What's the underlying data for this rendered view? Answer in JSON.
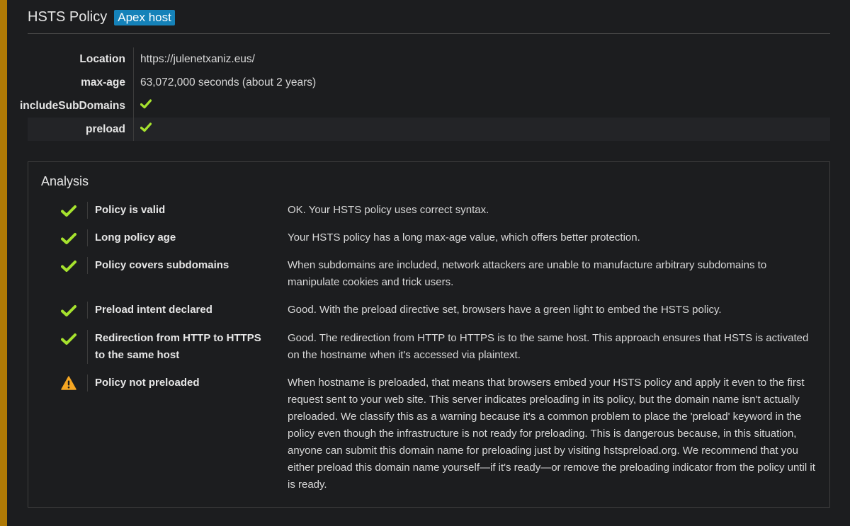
{
  "header": {
    "title": "HSTS Policy",
    "badge": "Apex host"
  },
  "policy": [
    {
      "key": "Location",
      "value": "https://julenetxaniz.eus/",
      "check": false
    },
    {
      "key": "max-age",
      "value": "63,072,000 seconds (about 2 years)",
      "check": false
    },
    {
      "key": "includeSubDomains",
      "value": "",
      "check": true
    },
    {
      "key": "preload",
      "value": "",
      "check": true
    }
  ],
  "analysis": {
    "title": "Analysis",
    "items": [
      {
        "status": "check-icon",
        "name": "Policy is valid",
        "desc": "OK. Your HSTS policy uses correct syntax."
      },
      {
        "status": "check-icon",
        "name": "Long policy age",
        "desc": "Your HSTS policy has a long max-age value, which offers better protection."
      },
      {
        "status": "check-icon",
        "name": "Policy covers subdomains",
        "desc": "When subdomains are included, network attackers are unable to manufacture arbitrary subdomains to manipulate cookies and trick users."
      },
      {
        "status": "check-icon",
        "name": "Preload intent declared",
        "desc": "Good. With the preload directive set, browsers have a green light to embed the HSTS policy."
      },
      {
        "status": "check-icon",
        "name": "Redirection from HTTP to HTTPS to the same host",
        "desc": "Good. The redirection from HTTP to HTTPS is to the same host. This approach ensures that HSTS is activated on the hostname when it's accessed via plaintext."
      },
      {
        "status": "warning-icon",
        "name": "Policy not preloaded",
        "desc": "When hostname is preloaded, that means that browsers embed your HSTS policy and apply it even to the first request sent to your web site. This server indicates preloading in its policy, but the domain name isn't actually preloaded. We classify this as a warning because it's a common problem to place the 'preload' keyword in the policy even though the infrastructure is not ready for preloading. This is dangerous because, in this situation, anyone can submit this domain name for preloading just by visiting hstspreload.org. We recommend that you either preload this domain name yourself—if it's ready—or remove the preloading indicator from the policy until it is ready."
      }
    ]
  },
  "colors": {
    "accent": "#b07a06",
    "badge": "#1582b9",
    "ok": "#a6e22e",
    "warning": "#f5a623"
  }
}
